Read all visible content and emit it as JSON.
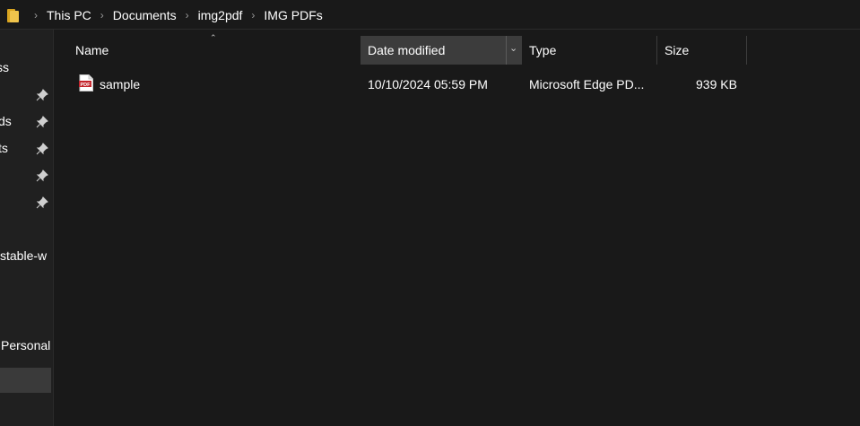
{
  "breadcrumb": {
    "items": [
      "This PC",
      "Documents",
      "img2pdf",
      "IMG PDFs"
    ]
  },
  "nav": {
    "items": [
      {
        "label": "ss"
      },
      {
        "label": ""
      },
      {
        "label": "ds"
      },
      {
        "label": "ts"
      },
      {
        "label": ""
      },
      {
        "label": ""
      },
      {
        "label": "stable-w"
      },
      {
        "label": "Personal"
      }
    ]
  },
  "columns": {
    "name": "Name",
    "date": "Date modified",
    "type": "Type",
    "size": "Size"
  },
  "files": [
    {
      "name": "sample",
      "date": "10/10/2024 05:59 PM",
      "type": "Microsoft Edge PD...",
      "size": "939 KB",
      "icon": "pdf-file-icon",
      "icon_text": "PDF"
    }
  ],
  "colors": {
    "background": "#191919",
    "nav_background": "#202020",
    "sorted_header": "#3c3c3c",
    "pdf_red": "#c4252c",
    "folder_yellow": "#f0c44c"
  }
}
